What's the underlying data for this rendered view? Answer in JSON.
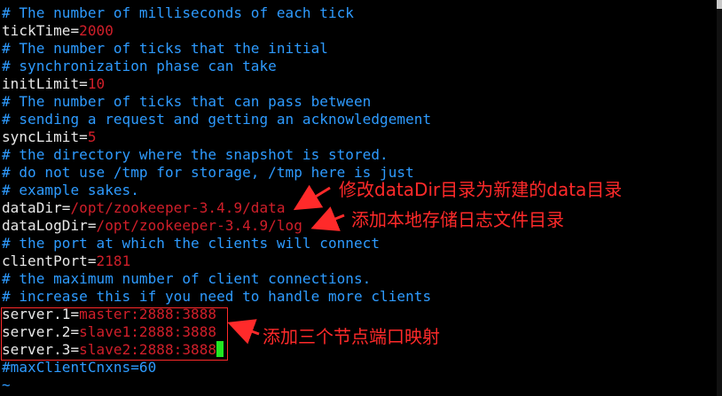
{
  "editor": {
    "lines": [
      {
        "type": "comment",
        "text": "# The number of milliseconds of each tick"
      },
      {
        "type": "kv",
        "key": "tickTime=",
        "value": "2000"
      },
      {
        "type": "comment",
        "text": "# The number of ticks that the initial"
      },
      {
        "type": "comment",
        "text": "# synchronization phase can take"
      },
      {
        "type": "kv",
        "key": "initLimit=",
        "value": "10"
      },
      {
        "type": "comment",
        "text": "# The number of ticks that can pass between"
      },
      {
        "type": "comment",
        "text": "# sending a request and getting an acknowledgement"
      },
      {
        "type": "kv",
        "key": "syncLimit=",
        "value": "5"
      },
      {
        "type": "comment",
        "text": "# the directory where the snapshot is stored."
      },
      {
        "type": "comment",
        "text": "# do not use /tmp for storage, /tmp here is just"
      },
      {
        "type": "comment",
        "text": "# example sakes."
      },
      {
        "type": "kv",
        "key": "dataDir=",
        "value": "/opt/zookeeper-3.4.9/data"
      },
      {
        "type": "kv",
        "key": "dataLogDir=",
        "value": "/opt/zookeeper-3.4.9/log"
      },
      {
        "type": "comment",
        "text": "# the port at which the clients will connect"
      },
      {
        "type": "kv",
        "key": "clientPort=",
        "value": "2181"
      },
      {
        "type": "comment",
        "text": "# the maximum number of client connections."
      },
      {
        "type": "comment",
        "text": "# increase this if you need to handle more clients"
      },
      {
        "type": "kv",
        "key": "server.1=",
        "value": "master:2888:3888"
      },
      {
        "type": "kv",
        "key": "server.2=",
        "value": "slave1:2888:3888"
      },
      {
        "type": "kv",
        "key": "server.3=",
        "value": "slave2:2888:3888",
        "cursor": true
      },
      {
        "type": "comment",
        "text": "#maxClientCnxns=60"
      },
      {
        "type": "tilde",
        "text": "~"
      }
    ]
  },
  "annotations": {
    "note_datadir": "修改dataDir目录为新建的data目录",
    "note_datalogdir": "添加本地存储日志文件目录",
    "note_servers": "添加三个节点端口映射"
  },
  "colors": {
    "comment": "#2e9bff",
    "key": "#e8e8e8",
    "value": "#d11f2a",
    "cursor": "#22e622",
    "annotation": "#ff2a2a"
  }
}
